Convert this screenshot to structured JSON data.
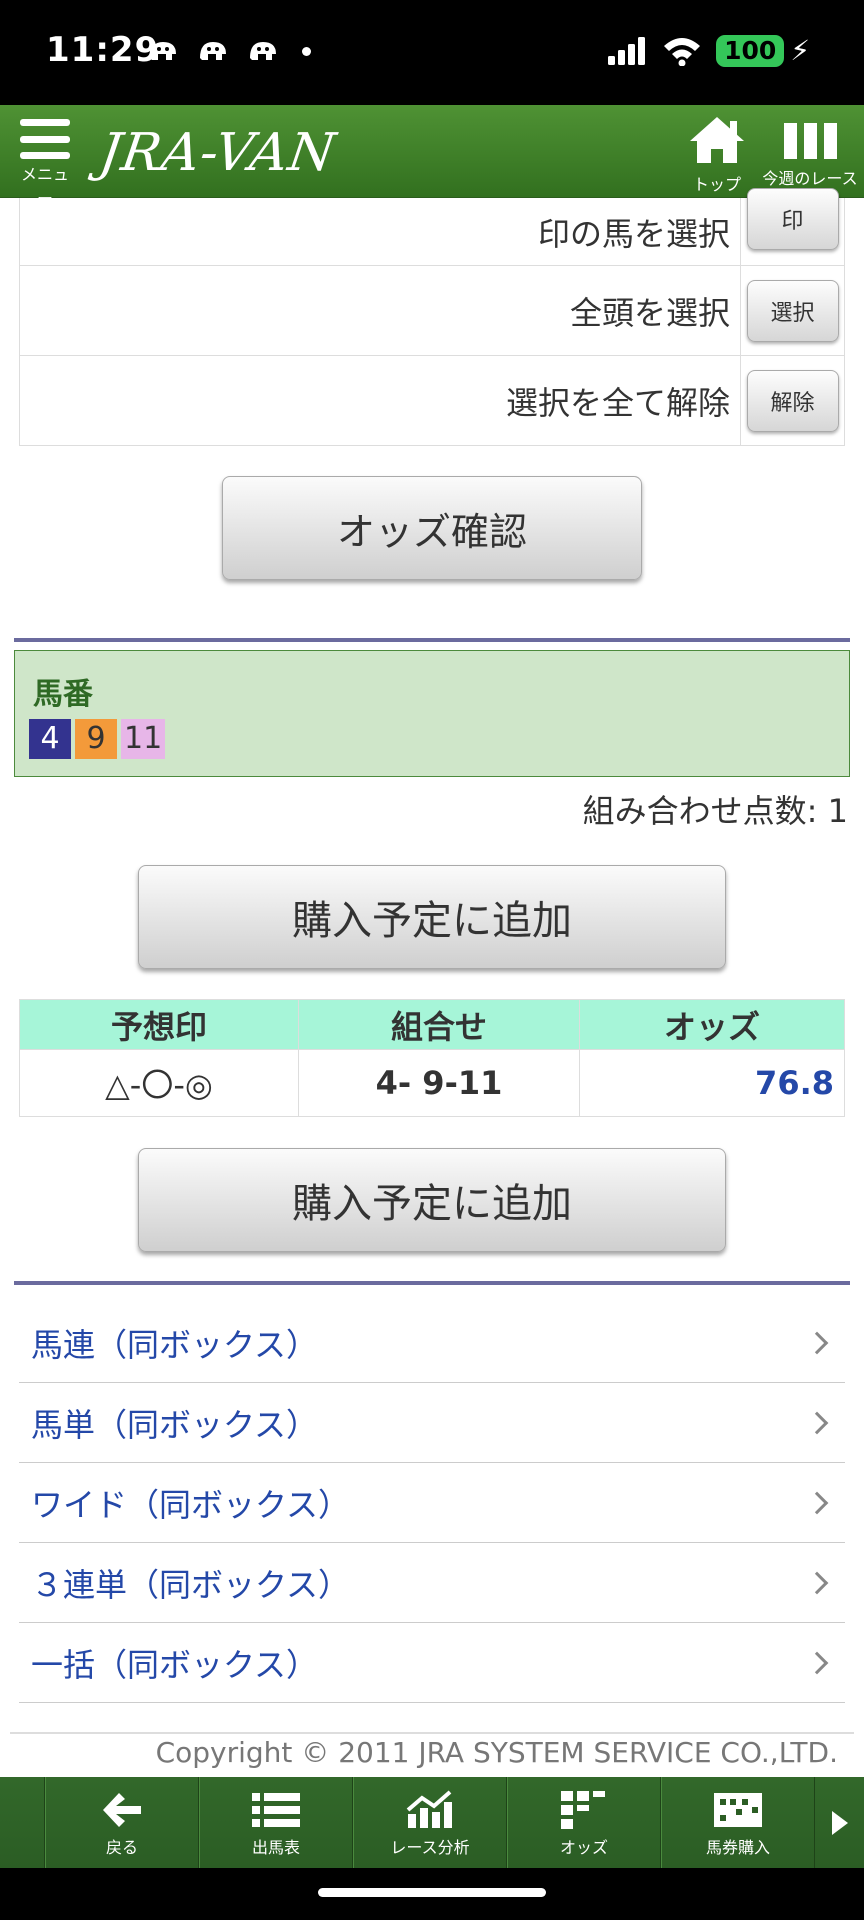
{
  "status_bar": {
    "time": "11:29",
    "battery": "100"
  },
  "header": {
    "menu_label": "メニュー",
    "logo": "JRA-VAN",
    "top_label": "トップ",
    "week_label": "今週のレース"
  },
  "select_rows": [
    {
      "label": "印の馬を選択",
      "button": "印"
    },
    {
      "label": "全頭を選択",
      "button": "選択"
    },
    {
      "label": "選択を全て解除",
      "button": "解除"
    }
  ],
  "odds_check_button": "オッズ確認",
  "horse_box": {
    "title": "馬番",
    "numbers": [
      {
        "value": "4",
        "bg": "#33338f",
        "fg": "#ffffff"
      },
      {
        "value": "9",
        "bg": "#f39a3a",
        "fg": "#333333"
      },
      {
        "value": "11",
        "bg": "#e7b6e8",
        "fg": "#333333"
      }
    ]
  },
  "combo_count": "組み合わせ点数: 1",
  "add_button_label": "購入予定に追加",
  "result_table": {
    "headers": [
      "予想印",
      "組合せ",
      "オッズ"
    ],
    "rows": [
      {
        "marks": "△-〇-◎",
        "combo": "4- 9-11",
        "odds": "76.8"
      }
    ]
  },
  "links": [
    "馬連（同ボックス）",
    "馬単（同ボックス）",
    "ワイド（同ボックス）",
    "３連単（同ボックス）",
    "一括（同ボックス）"
  ],
  "copyright": "Copyright © 2011 JRA SYSTEM SERVICE CO.,LTD.",
  "bottom_nav": [
    "戻る",
    "出馬表",
    "レース分析",
    "オッズ",
    "馬券購入"
  ],
  "colors": {
    "header_green": "#3e7f2b",
    "link_blue": "#2448a8",
    "table_header": "#a6f5d8",
    "horse_box_bg": "#cfe6c9"
  }
}
